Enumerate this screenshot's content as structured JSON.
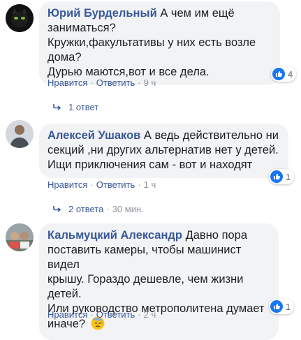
{
  "comments": [
    {
      "author": "Юрий Бурдельный",
      "text_lines": [
        "А чем им ещё",
        "заниматься?",
        "Кружки,факультативы у них есть возле дома?",
        "Дурью маются,вот и все дела."
      ],
      "like_label": "Нравится",
      "reply_label": "Ответить",
      "time": "9 ч",
      "reactions": "4",
      "replies": "1 ответ",
      "replies_time": ""
    },
    {
      "author": "Алексей Ушаков",
      "text_lines": [
        "А ведь действительно ни",
        "секций ,ни других альтернатив нет у детей.",
        "Ищи приключения сам - вот и находят"
      ],
      "like_label": "Нравится",
      "reply_label": "Ответить",
      "time": "1 ч",
      "reactions": "1",
      "replies": "2 ответа",
      "replies_time": "30 мин."
    },
    {
      "author": "Кальмуцкий Александр",
      "text_lines": [
        "Давно пора",
        "поставить камеры, чтобы машинист видел",
        "крышу. Гораздо дешевле, чем жизни детей.",
        "Или руководство метрополитена думает",
        "иначе?"
      ],
      "like_label": "Нравится",
      "reply_label": "Ответить",
      "time": "2 ч",
      "reactions": "1",
      "replies": "",
      "replies_time": ""
    }
  ],
  "colors": {
    "name": "#385898",
    "bubble": "#f2f3f5",
    "like": "#1877f2"
  },
  "icons": [
    "like-icon",
    "reply-arrow-icon",
    "downcast-face-emoji"
  ]
}
